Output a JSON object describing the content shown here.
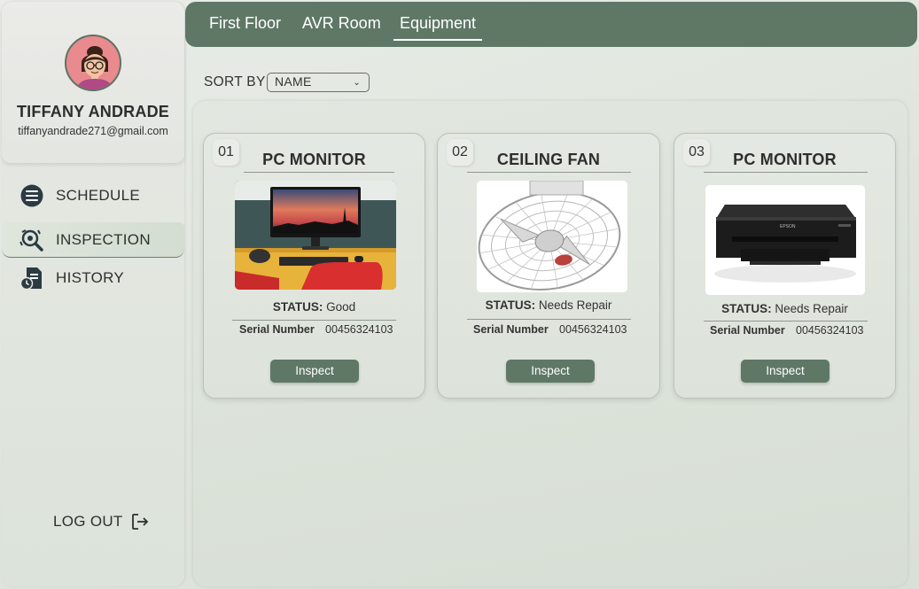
{
  "user": {
    "name": "TIFFANY ANDRADE",
    "email": "tiffanyandrade271@gmail.com"
  },
  "nav": {
    "items": [
      {
        "label": "SCHEDULE",
        "icon": "schedule-icon",
        "active": false
      },
      {
        "label": "INSPECTION",
        "icon": "inspection-icon",
        "active": true
      },
      {
        "label": "HISTORY",
        "icon": "history-icon",
        "active": false
      }
    ],
    "logout_label": "LOG OUT"
  },
  "breadcrumb": {
    "tabs": [
      {
        "label": "First Floor",
        "active": false
      },
      {
        "label": "AVR Room",
        "active": false
      },
      {
        "label": "Equipment",
        "active": true
      }
    ]
  },
  "sort": {
    "label": "SORT BY",
    "selected": "NAME"
  },
  "cards": [
    {
      "number": "01",
      "title": "PC MONITOR",
      "status_label": "STATUS:",
      "status_value": "Good",
      "serial_label": "Serial Number",
      "serial_value": "00456324103",
      "button": "Inspect",
      "image": "pc-monitor-desk-photo"
    },
    {
      "number": "02",
      "title": "CEILING FAN",
      "status_label": "STATUS:",
      "status_value": "Needs Repair",
      "serial_label": "Serial Number",
      "serial_value": "00456324103",
      "button": "Inspect",
      "image": "ceiling-fan-photo"
    },
    {
      "number": "03",
      "title": "PC MONITOR",
      "status_label": "STATUS:",
      "status_value": "Needs Repair",
      "serial_label": "Serial Number",
      "serial_value": "00456324103",
      "button": "Inspect",
      "image": "printer-photo"
    }
  ],
  "colors": {
    "accent": "#5f7866",
    "background": "#e3e8e1",
    "avatar_bg": "#e98a8f"
  }
}
